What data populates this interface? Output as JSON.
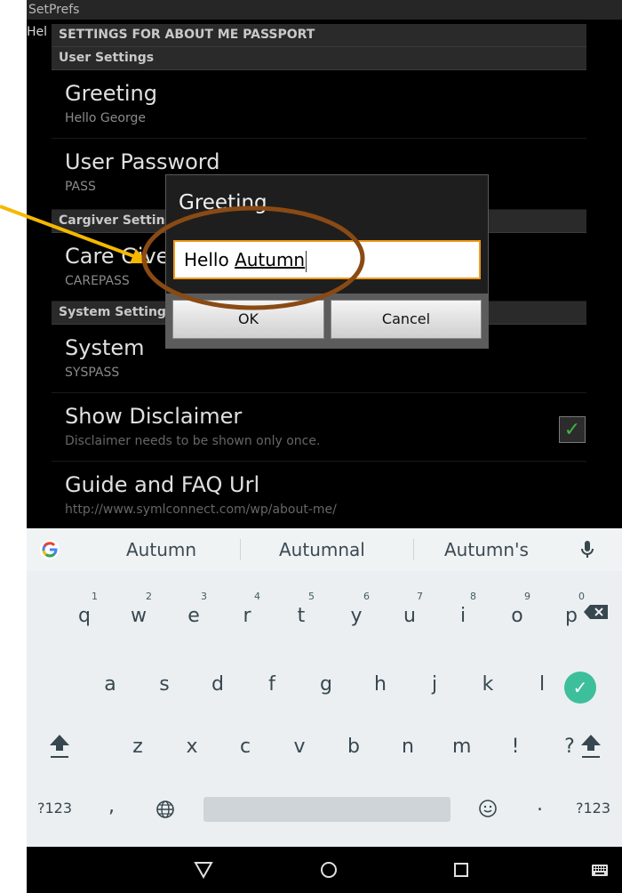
{
  "app": {
    "title": "SetPrefs",
    "left_fragment": "Hel"
  },
  "settings": {
    "header": "SETTINGS FOR ABOUT ME PASSPORT",
    "sections": {
      "user": "User Settings",
      "caregiver": "Cargiver Settin",
      "system": "System Setting"
    },
    "prefs": {
      "greeting": {
        "title": "Greeting",
        "summary": "Hello George"
      },
      "password": {
        "title": "User Password",
        "summary": "PASS"
      },
      "caregiver": {
        "title": "Care Give",
        "summary": "CAREPASS"
      },
      "system": {
        "title": "System",
        "summary": "SYSPASS"
      },
      "disclaimer": {
        "title": "Show Disclaimer",
        "summary": "Disclaimer needs to be shown only once.",
        "checked": true
      },
      "faq": {
        "title": "Guide and FAQ Url",
        "summary": "http://www.symlconnect.com/wp/about-me/"
      }
    }
  },
  "dialog": {
    "title": "Greeting",
    "input_prefix": "Hello ",
    "input_word": "Autumn",
    "ok": "OK",
    "cancel": "Cancel"
  },
  "keyboard": {
    "suggestions": [
      "Autumn",
      "Autumnal",
      "Autumn's"
    ],
    "row1": [
      "q",
      "w",
      "e",
      "r",
      "t",
      "y",
      "u",
      "i",
      "o",
      "p"
    ],
    "row1_nums": [
      "1",
      "2",
      "3",
      "4",
      "5",
      "6",
      "7",
      "8",
      "9",
      "0"
    ],
    "row2": [
      "a",
      "s",
      "d",
      "f",
      "g",
      "h",
      "j",
      "k",
      "l"
    ],
    "row3": [
      "z",
      "x",
      "c",
      "v",
      "b",
      "n",
      "m",
      "!",
      "?"
    ],
    "sym_label": "?123",
    "comma": ",",
    "period": "."
  },
  "colors": {
    "accent": "#f39a1a",
    "enter": "#3dbf9b",
    "annotation_arrow": "#f5b800",
    "annotation_circle": "#8a4a14"
  }
}
